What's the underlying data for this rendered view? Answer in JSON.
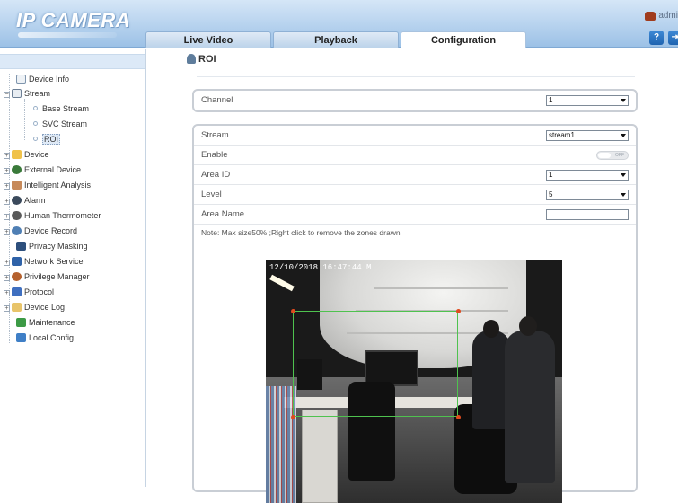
{
  "app": {
    "logo": "IP CAMERA",
    "user": "admi"
  },
  "tabs": {
    "live": "Live Video",
    "playback": "Playback",
    "configuration": "Configuration"
  },
  "header_buttons": {
    "help": "?",
    "exit": "⇥"
  },
  "sidebar": {
    "device_info": "Device Info",
    "stream": "Stream",
    "base_stream": "Base Stream",
    "svc_stream": "SVC Stream",
    "roi": "ROI",
    "device": "Device",
    "external_device": "External Device",
    "intelligent_analysis": "Intelligent Analysis",
    "alarm": "Alarm",
    "human_thermometer": "Human Thermometer",
    "device_record": "Device Record",
    "privacy_masking": "Privacy Masking",
    "network_service": "Network Service",
    "privilege_manager": "Privilege Manager",
    "protocol": "Protocol",
    "device_log": "Device Log",
    "maintenance": "Maintenance",
    "local_config": "Local Config"
  },
  "page": {
    "title": "ROI"
  },
  "channel": {
    "label": "Channel",
    "value": "1"
  },
  "form": {
    "stream_label": "Stream",
    "stream_value": "stream1",
    "enable_label": "Enable",
    "enable_state": "OFF",
    "area_id_label": "Area ID",
    "area_id_value": "1",
    "level_label": "Level",
    "level_value": "5",
    "area_name_label": "Area Name",
    "area_name_value": "",
    "note": "Note: Max size50% ;Right click to remove the zones drawn"
  },
  "video": {
    "osd_timestamp": "12/10/2018 16:47:44 M"
  },
  "colors": {
    "header_blue": "#b6d2ee",
    "roi_green": "#4fc24f",
    "roi_handle": "#e04b1e"
  }
}
